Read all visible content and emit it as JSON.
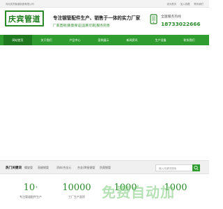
{
  "topbar": {
    "company": "河北庆宾管道制造有限公司",
    "links": [
      "设为首页",
      "加入收藏",
      "联系我们"
    ]
  },
  "header": {
    "logo_text": "庆宾管道",
    "slogan": "专注钢管配件生产、销售于一体的实力厂家",
    "subtags": "厂家直销|质量保证|品质可靠|服务完善",
    "hotline_label": "全国服务热线",
    "hotline_number": "18733022666",
    "hotline_icon": "phone-icon"
  },
  "nav": {
    "items": [
      "网站首页",
      "关于我们",
      "产品中心",
      "案例展示",
      "新闻资讯",
      "生产设备",
      "联系我们"
    ],
    "active_index": 0
  },
  "hot": {
    "title": "热门关键词",
    "keywords": [
      "螺旋管",
      "直缝钢管",
      "消体/合金元",
      "合金/焊接钢管",
      "防腐钢管"
    ],
    "search_placeholder": "输入关键词搜索"
  },
  "stats": [
    {
      "num": "10",
      "sup": "+",
      "caption": "专注管道配件生产"
    },
    {
      "num": "10000",
      "sup": "",
      "caption": "工厂生产面积"
    },
    {
      "num": "1000",
      "sup": "",
      "caption": ""
    },
    {
      "num": "1000",
      "sup": "",
      "caption": ""
    }
  ],
  "watermark": {
    "text": "免费自动加"
  },
  "colors": {
    "brand_green": "#2f9d2f",
    "active_nav": "#1f7a1f"
  }
}
